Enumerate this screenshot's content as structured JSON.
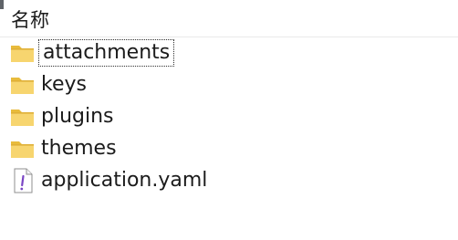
{
  "header": {
    "name_column": "名称"
  },
  "items": [
    {
      "label": "attachments",
      "icon": "folder-icon"
    },
    {
      "label": "keys",
      "icon": "folder-icon"
    },
    {
      "label": "plugins",
      "icon": "folder-icon"
    },
    {
      "label": "themes",
      "icon": "folder-icon"
    },
    {
      "label": "application.yaml",
      "icon": "yaml-file-icon"
    }
  ],
  "colors": {
    "folder_fill": "#f7d56f",
    "folder_back": "#e8bb3c",
    "focus_border": "#303030",
    "yaml_mark": "#7a45c4"
  }
}
